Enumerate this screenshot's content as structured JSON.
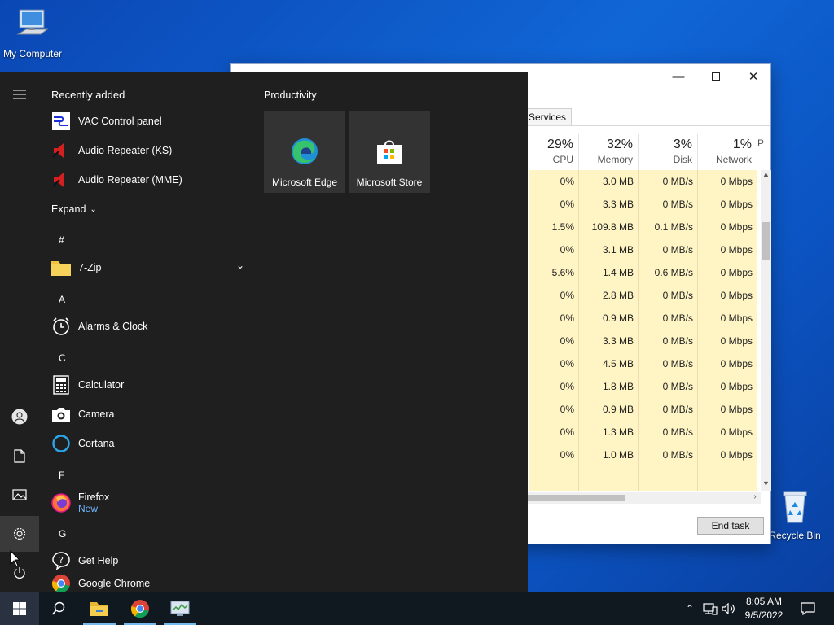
{
  "desktop": {
    "my_computer": "My Computer",
    "recycle_bin": "Recycle Bin"
  },
  "task_manager": {
    "tab_services": "Services",
    "columns": [
      {
        "pct": "29%",
        "label": "CPU"
      },
      {
        "pct": "32%",
        "label": "Memory"
      },
      {
        "pct": "3%",
        "label": "Disk"
      },
      {
        "pct": "1%",
        "label": "Network"
      },
      {
        "pct": "",
        "label": "P"
      }
    ],
    "rows": [
      [
        "0%",
        "3.0 MB",
        "0 MB/s",
        "0 Mbps"
      ],
      [
        "0%",
        "3.3 MB",
        "0 MB/s",
        "0 Mbps"
      ],
      [
        "1.5%",
        "109.8 MB",
        "0.1 MB/s",
        "0 Mbps"
      ],
      [
        "0%",
        "3.1 MB",
        "0 MB/s",
        "0 Mbps"
      ],
      [
        "5.6%",
        "1.4 MB",
        "0.6 MB/s",
        "0 Mbps"
      ],
      [
        "0%",
        "2.8 MB",
        "0 MB/s",
        "0 Mbps"
      ],
      [
        "0%",
        "0.9 MB",
        "0 MB/s",
        "0 Mbps"
      ],
      [
        "0%",
        "3.3 MB",
        "0 MB/s",
        "0 Mbps"
      ],
      [
        "0%",
        "4.5 MB",
        "0 MB/s",
        "0 Mbps"
      ],
      [
        "0%",
        "1.8 MB",
        "0 MB/s",
        "0 Mbps"
      ],
      [
        "0%",
        "0.9 MB",
        "0 MB/s",
        "0 Mbps"
      ],
      [
        "0%",
        "1.3 MB",
        "0 MB/s",
        "0 Mbps"
      ],
      [
        "0%",
        "1.0 MB",
        "0 MB/s",
        "0 Mbps"
      ]
    ],
    "end_task": "End task"
  },
  "start_menu": {
    "recently_added": "Recently added",
    "recent_apps": [
      "VAC Control panel",
      "Audio Repeater (KS)",
      "Audio Repeater (MME)"
    ],
    "expand": "Expand",
    "letters": [
      "#",
      "A",
      "C",
      "F",
      "G"
    ],
    "apps": {
      "seven_zip": "7-Zip",
      "alarms": "Alarms & Clock",
      "calculator": "Calculator",
      "camera": "Camera",
      "cortana": "Cortana",
      "firefox": "Firefox",
      "firefox_badge": "New",
      "get_help": "Get Help",
      "chrome": "Google Chrome"
    },
    "productivity": "Productivity",
    "tiles": [
      "Microsoft Edge",
      "Microsoft Store"
    ]
  },
  "taskbar": {
    "time": "8:05 AM",
    "date": "9/5/2022"
  },
  "colors": {
    "highlight_cells": "#fff4c4",
    "accent": "#76b9ed"
  }
}
